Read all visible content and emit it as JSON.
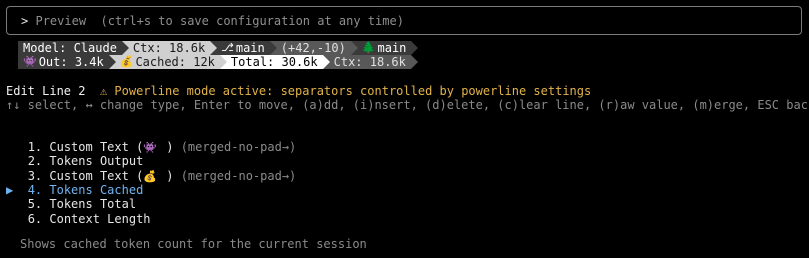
{
  "preview": {
    "prompt_char": ">",
    "label": "Preview",
    "hint": "(ctrl+s to save configuration at any time)"
  },
  "powerline": {
    "row1": [
      {
        "text": "Model: Claude",
        "bg": "#3a3a3a",
        "fg": "#ffffff"
      },
      {
        "text": "Ctx: 18.6k",
        "bg": "#d0d0d0",
        "fg": "#1a1a1a"
      },
      {
        "icon": "branch-icon",
        "icon_glyph": "⎇",
        "text": "main",
        "bg": "#3a3a3a",
        "fg": "#ffffff"
      },
      {
        "text": "(+42,-10)",
        "bg": "#585858",
        "fg": "#e0e0e0"
      },
      {
        "icon": "tree-icon",
        "icon_glyph": "🌲",
        "text": "main",
        "bg": "#3a3a3a",
        "fg": "#ffffff"
      }
    ],
    "row2": [
      {
        "icon": "alien-monster-icon",
        "icon_glyph": "👾",
        "text": "Out: 3.4k",
        "bg": "#3a3a3a",
        "fg": "#ffffff"
      },
      {
        "icon": "money-bag-icon",
        "icon_glyph": "💰",
        "text": "Cached: 12k",
        "bg": "#d0d0d0",
        "fg": "#1a1a1a"
      },
      {
        "text": "Total: 30.6k",
        "bg": "#ffffff",
        "fg": "#000000"
      },
      {
        "text": "Ctx: 18.6k",
        "bg": "#585858",
        "fg": "#e0e0e0"
      }
    ]
  },
  "edit": {
    "title": "Edit Line 2",
    "warning_icon": "⚠",
    "warning": "Powerline mode active: separators controlled by powerline settings",
    "help": "↑↓ select, ↔ change type, Enter to move, (a)dd, (i)nsert, (d)elete, (c)lear line, (r)aw value, (m)erge, ESC back"
  },
  "items": [
    {
      "num": "1.",
      "label": "Custom Text (",
      "icon": "alien-monster-icon",
      "icon_glyph": "👾",
      "suffix": " )",
      "tag": "(merged-no-pad→)"
    },
    {
      "num": "2.",
      "label": "Tokens Output",
      "icon": "",
      "icon_glyph": "",
      "suffix": "",
      "tag": ""
    },
    {
      "num": "3.",
      "label": "Custom Text (",
      "icon": "money-bag-icon",
      "icon_glyph": "💰",
      "suffix": " )",
      "tag": "(merged-no-pad→)"
    },
    {
      "num": "4.",
      "label": "Tokens Cached",
      "icon": "",
      "icon_glyph": "",
      "suffix": "",
      "tag": "",
      "selected": true
    },
    {
      "num": "5.",
      "label": "Tokens Total",
      "icon": "",
      "icon_glyph": "",
      "suffix": "",
      "tag": ""
    },
    {
      "num": "6.",
      "label": "Context Length",
      "icon": "",
      "icon_glyph": "",
      "suffix": "",
      "tag": ""
    }
  ],
  "cursor_glyph": "▶",
  "selected_index": 3,
  "description": "Shows cached token count for the current session",
  "colors": {
    "background": "#000000",
    "text": "#e6e6e6",
    "dim": "#8a8a8a",
    "warning": "#e2b34a",
    "selected": "#6fb4f2"
  }
}
